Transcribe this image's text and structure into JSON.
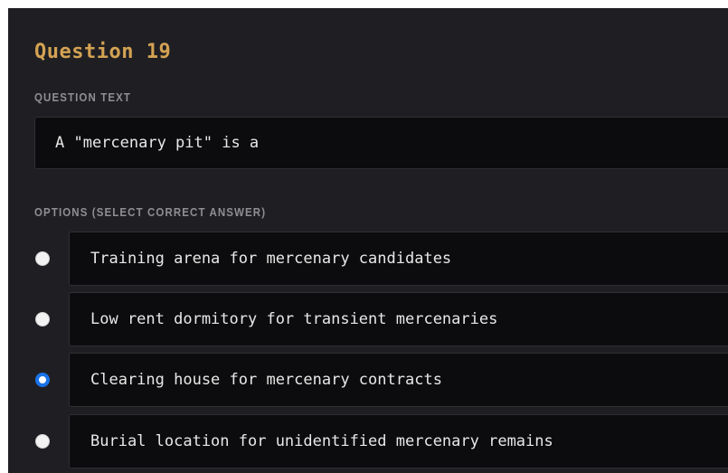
{
  "question": {
    "title": "Question 19",
    "text_label": "QUESTION TEXT",
    "text": "A \"mercenary pit\" is a"
  },
  "options_section": {
    "label": "OPTIONS (SELECT CORRECT ANSWER)",
    "selected_index": 2,
    "options": [
      {
        "label": "Training arena for mercenary candidates",
        "selected": false
      },
      {
        "label": "Low rent dormitory for transient mercenaries",
        "selected": false
      },
      {
        "label": "Clearing house for mercenary contracts",
        "selected": true
      },
      {
        "label": "Burial location for unidentified mercenary remains",
        "selected": false
      }
    ]
  },
  "colors": {
    "background": "#1f1f23",
    "field_background": "#0c0c0e",
    "title": "#d4a253",
    "label": "#8f8f93",
    "radio_selected": "#1a73e8"
  }
}
